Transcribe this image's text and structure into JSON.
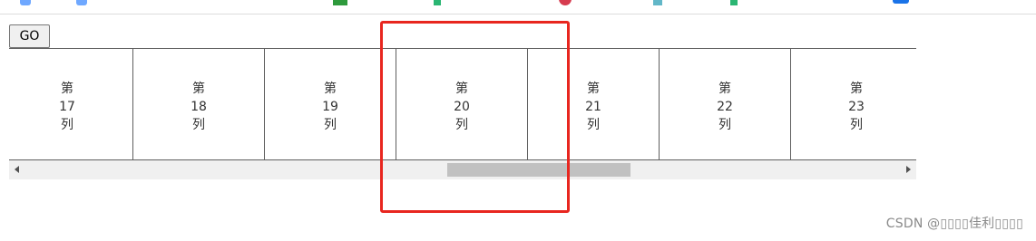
{
  "toolbar": {
    "go_label": "GO"
  },
  "grid": {
    "scroll_position": 0.53,
    "columns": [
      {
        "prefix": "第",
        "number": "17",
        "suffix": "列"
      },
      {
        "prefix": "第",
        "number": "18",
        "suffix": "列"
      },
      {
        "prefix": "第",
        "number": "19",
        "suffix": "列"
      },
      {
        "prefix": "第",
        "number": "20",
        "suffix": "列"
      },
      {
        "prefix": "第",
        "number": "21",
        "suffix": "列"
      },
      {
        "prefix": "第",
        "number": "22",
        "suffix": "列"
      },
      {
        "prefix": "第",
        "number": "23",
        "suffix": "列"
      }
    ]
  },
  "highlight": {
    "color": "#e8261f",
    "target_column": "20"
  },
  "watermark": {
    "text": "CSDN @▯▯▯▯佳利▯▯▯▯"
  },
  "icons": [
    "shield-icon",
    "green-bookmark-icon",
    "red-bookmark-icon",
    "blue-bookmark-icon",
    "arrow-left-icon",
    "arrow-right-icon"
  ]
}
